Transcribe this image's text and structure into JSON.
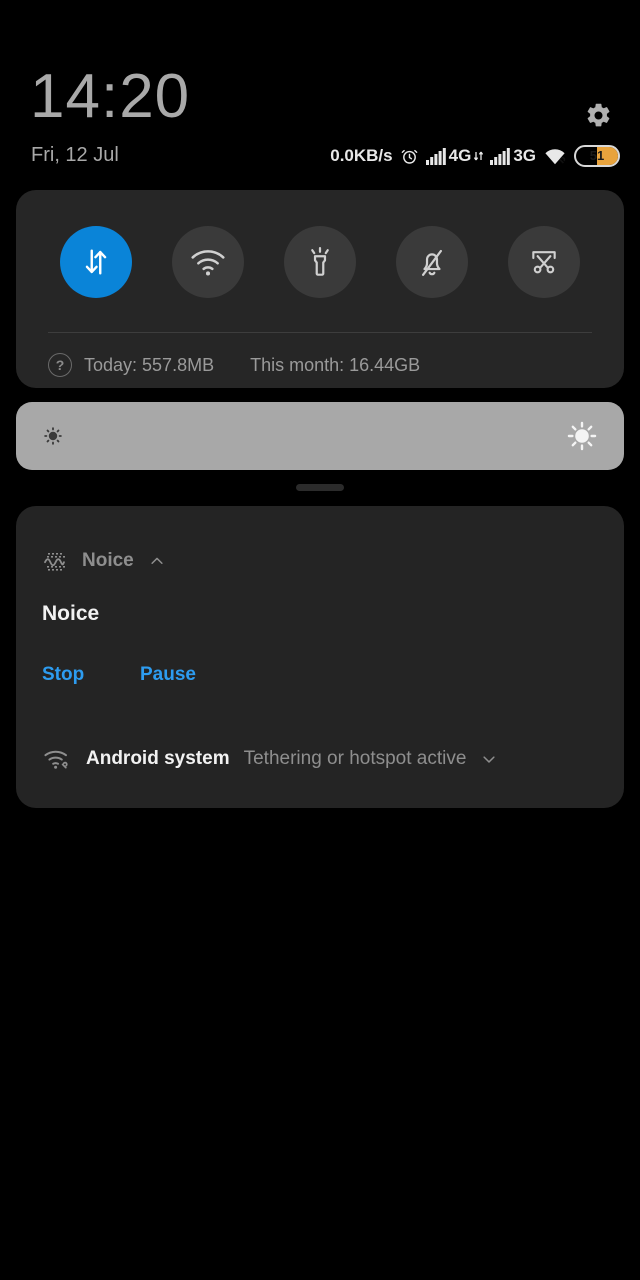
{
  "statusbar": {
    "clock": "14:20",
    "date": "Fri, 12 Jul",
    "network_speed": "0.0KB/s",
    "alarm_icon": "alarm-clock-icon",
    "sim1_network": "4G",
    "sim2_network": "3G",
    "wifi_icon": "wifi-tether-icon",
    "battery_percent": "51",
    "battery_level": 51,
    "battery_color": "#e8a33d",
    "settings_icon": "gear-icon"
  },
  "quick_settings": {
    "tiles": [
      {
        "name": "mobile-data",
        "icon": "data-arrows-icon",
        "active": true,
        "label": "Mobile data"
      },
      {
        "name": "wifi",
        "icon": "wifi-icon",
        "active": false,
        "label": "Wi-Fi"
      },
      {
        "name": "flashlight",
        "icon": "flashlight-icon",
        "active": false,
        "label": "Flashlight"
      },
      {
        "name": "silent",
        "icon": "bell-muted-icon",
        "active": false,
        "label": "Silent"
      },
      {
        "name": "screenshot",
        "icon": "scissors-frame-icon",
        "active": false,
        "label": "Screenshot"
      }
    ],
    "help_glyph": "?",
    "data_today": "Today: 557.8MB",
    "data_month": "This month: 16.44GB",
    "active_color": "#0a84d8"
  },
  "brightness": {
    "value_percent": 100,
    "low_icon": "brightness-low-icon",
    "high_icon": "brightness-high-icon",
    "track_color": "#a8a8a8"
  },
  "notifications": [
    {
      "app_icon": "waveform-icon",
      "app_name": "Noice",
      "expand_icon": "chevron-up-icon",
      "title": "Noice",
      "actions": [
        {
          "name": "stop-action",
          "label": "Stop"
        },
        {
          "name": "pause-action",
          "label": "Pause"
        }
      ],
      "action_color": "#2d9cf0"
    },
    {
      "app_icon": "wifi-tether-icon",
      "app_name": "Android system",
      "summary": "Tethering or hotspot active",
      "expand_icon": "chevron-down-icon"
    }
  ]
}
